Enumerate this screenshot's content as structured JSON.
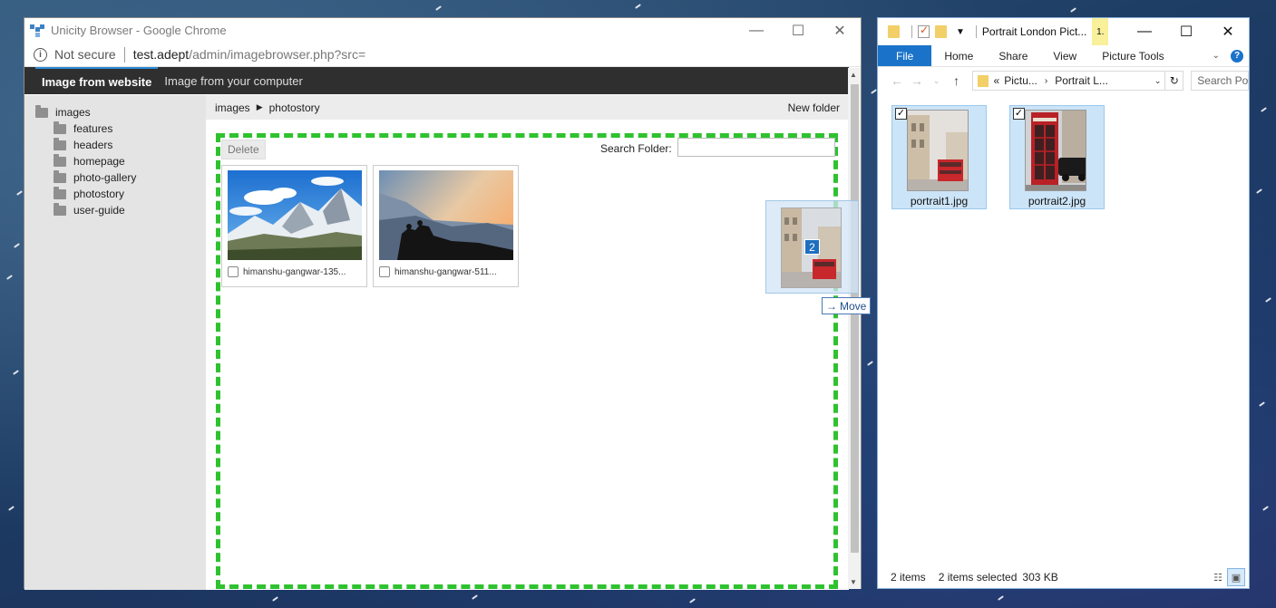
{
  "chrome": {
    "title": "Unicity Browser - Google Chrome",
    "security": "Not secure",
    "url_host": "test.adept",
    "url_path": "/admin/imagebrowser.php?src=",
    "tabs": [
      "Image from website",
      "Image from your computer"
    ],
    "folders": {
      "root": "images",
      "children": [
        "features",
        "headers",
        "homepage",
        "photo-gallery",
        "photostory",
        "user-guide"
      ]
    },
    "breadcrumb": [
      "images",
      "photostory"
    ],
    "new_folder": "New folder",
    "delete": "Delete",
    "search_label": "Search Folder:",
    "search_value": "",
    "images": [
      {
        "name": "himanshu-gangwar-135..."
      },
      {
        "name": "himanshu-gangwar-511..."
      }
    ]
  },
  "drag": {
    "count": "2",
    "action": "Move"
  },
  "explorer": {
    "title": "Portrait London Pict...",
    "mgmt_badge": "1.",
    "ribbon_tabs": [
      "File",
      "Home",
      "Share",
      "View",
      "Picture Tools"
    ],
    "address": {
      "prefix": "«",
      "parts": [
        "Pictu...",
        "Portrait L..."
      ]
    },
    "search_placeholder": "Search Po...",
    "files": [
      {
        "name": "portrait1.jpg"
      },
      {
        "name": "portrait2.jpg"
      }
    ],
    "status": {
      "items": "2 items",
      "selected": "2 items selected",
      "size": "303 KB"
    }
  },
  "colors": {
    "dropzone": "#2ec22e",
    "accent": "#1a73c9",
    "selection": "#cce4f7"
  }
}
